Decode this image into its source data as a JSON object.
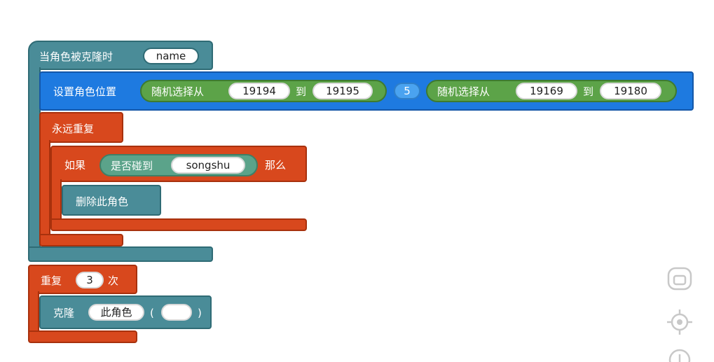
{
  "when_cloned": {
    "label": "当角色被克隆时",
    "param": "name"
  },
  "set_position": {
    "label": "设置角色位置",
    "rand1": {
      "label": "随机选择从",
      "from": "19194",
      "to_label": "到",
      "to": "19195"
    },
    "middle_value": "5",
    "rand2": {
      "label": "随机选择从",
      "from": "19169",
      "to_label": "到",
      "to": "19180"
    }
  },
  "forever": {
    "label": "永远重复"
  },
  "if_block": {
    "if_label": "如果",
    "touching_label": "是否碰到",
    "target": "songshu",
    "then_label": "那么"
  },
  "delete_clone": {
    "label": "删除此角色"
  },
  "repeat": {
    "label_pre": "重复",
    "count": "3",
    "label_post": "次"
  },
  "clone": {
    "label": "克隆",
    "target": "此角色",
    "paren_open": "(",
    "paren_close": ")",
    "arg": ""
  },
  "toolbar": {
    "icons": [
      "fit-screen-icon",
      "center-target-icon",
      "zoom-icon"
    ]
  },
  "colors": {
    "teal": "#4a8c98",
    "blue": "#1e7ae0",
    "orange": "#d8481d",
    "green": "#5ca348"
  }
}
